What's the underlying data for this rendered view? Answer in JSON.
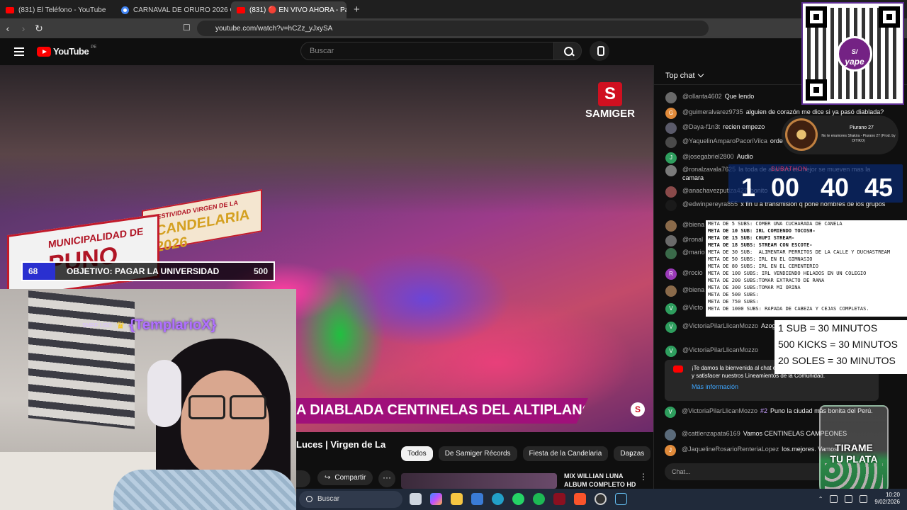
{
  "browser": {
    "tabs": [
      {
        "title": "(831) El Teléfono - YouTube",
        "icon": "youtube-icon",
        "active": false
      },
      {
        "title": "CARNAVAL DE ORURO 2026 CUANDO",
        "icon": "google-icon",
        "active": false
      },
      {
        "title": "(831) 🔴 EN VIVO AHORA - Para",
        "icon": "youtube-icon",
        "active": true
      }
    ],
    "url": "youtube.com/watch?v=hCZz_yJxySA"
  },
  "youtube": {
    "logo_text": "YouTube",
    "region": "PE",
    "search_placeholder": "Buscar"
  },
  "video": {
    "banner_municipal_l1": "MUNICIPALIDAD DE",
    "banner_municipal_l2": "PUNO",
    "banner_festival": "FESTIVIDAD VIRGEN DE LA",
    "banner_candelaria": "CANDELARIA 2026",
    "channel_logo_letter": "S",
    "channel_logo_text": "SAMIGER",
    "goal_current": "68",
    "goal_text": "OBJETIVO: PAGAR LA UNIVERSIDAD",
    "goal_max": "500",
    "goal_progress": 0.136,
    "lower_third": "A DIABLADA CENTINELAS DEL ALTIPLANO",
    "corner_mark": "S"
  },
  "webcam": {
    "sub_alert_pre": "SMRF USD",
    "sub_alert_name": "{TemplarioX}"
  },
  "below_video": {
    "title": "Luces | Virgen de La",
    "chips": [
      "Todos",
      "De Samiger Récords",
      "Fiesta de la Candelaria",
      "Danzas"
    ],
    "share_label": "Compartir",
    "rec_title": "MIX WILLIAN LUNA ALBUM COMPLETO HD"
  },
  "chat": {
    "header": "Top chat",
    "messages": [
      {
        "author": "@ollanta4602",
        "text": "Que lendo",
        "color": "#6a6a6a",
        "initial": ""
      },
      {
        "author": "@guimeralvarez9735",
        "text": "alguien de corazón me dice si ya pasó diablada?",
        "color": "#e08a3a",
        "initial": "G"
      },
      {
        "author": "@Daya-f1n3t",
        "text": "recien empezo",
        "color": "#5a5a6a",
        "initial": ""
      },
      {
        "author": "@YaquelinAmparoPacoriVilca",
        "text": "orde",
        "color": "#4a4a4a",
        "initial": ""
      },
      {
        "author": "@josegabriel2800",
        "text": "Audio",
        "color": "#2e9e5e",
        "initial": "J"
      },
      {
        "author": "@ronalzavala7625",
        "text": "la toda de allamiro es mejor se mueven mas la camara",
        "color": "#7a7a7a",
        "initial": ""
      },
      {
        "author": "@anachavezputiza427",
        "text": "bonito",
        "color": "#8a4a4a",
        "initial": ""
      },
      {
        "author": "@edwinpereyra855",
        "text": "x fin u a transmision q pone nombres de los grupos",
        "color": "#1a1a1a",
        "initial": ""
      },
      {
        "author": "@biena",
        "text": "",
        "color": "#8a6a4a",
        "initial": ""
      },
      {
        "author": "@ronal",
        "text": "",
        "color": "#6a6a6a",
        "initial": ""
      },
      {
        "author": "@mario",
        "text": "Candel",
        "color": "#3a6a4a",
        "initial": ""
      },
      {
        "author": "@rocio",
        "text": "mamita",
        "color": "#9a3ab8",
        "initial": "R"
      },
      {
        "author": "@biena",
        "text": "",
        "color": "#8a6a4a",
        "initial": ""
      },
      {
        "author": "@Victo",
        "text": "",
        "color": "#2e9e5e",
        "initial": "V"
      },
      {
        "author": "@VictoriaPilarLlicanMozzo",
        "text": "Azoguini 🏆",
        "color": "#2e9e5e",
        "initial": "V"
      },
      {
        "author": "@VictoriaPilarLlicanMozzo",
        "text": "",
        "color": "#2e9e5e",
        "initial": "V"
      }
    ],
    "notice_text": "¡Te damos la bienvenida al chat en vivo! Recuerda proteger tu privacidad y satisfacer nuestros Lineamientos de la Comunidad.",
    "notice_link": "Más información",
    "later_messages": [
      {
        "author": "@VictoriaPilarLlicanMozzo",
        "badge": "#2",
        "text": "Puno la ciudad más bonita del Perú.",
        "color": "#2e9e5e",
        "initial": "V"
      },
      {
        "author": "@cattlenzapata6169",
        "badge": "",
        "text": "Vamos CENTINELAS CAMPEONES",
        "color": "#5a6a7a",
        "initial": ""
      },
      {
        "author": "@JaquelineRosarioRenteriaLopez",
        "badge": "",
        "text": "los.mejores. Vamos",
        "color": "#e08a3a",
        "initial": "J"
      }
    ],
    "input_placeholder": "Chat..."
  },
  "overlays": {
    "qr_label": "yape",
    "qr_symbol": "S/",
    "now_playing_title": "Piurano 27",
    "now_playing_sub": "No te enamores Shakira - Piurano 27 (Prod. by DITIKO)",
    "timer_header": "SUBATHON",
    "timer": [
      "1",
      "00",
      "40",
      "45"
    ],
    "metas": [
      {
        "text": "META DE 5 SUBS: COMER UNA CUCHARADA DE CANELA",
        "bold": false
      },
      {
        "text": "META DE 10 SUB: IRL COMIENDO TOCOSH-",
        "bold": true
      },
      {
        "text": "META DE 15 SUB: CHUPI STREAM-",
        "bold": true
      },
      {
        "text": "META DE 18 SUBS: STREAM CON ESCOTE-",
        "bold": true
      },
      {
        "text": "META DE 30 SUB:  ALIMENTAR PERRITOS DE LA CALLE Y DUCHASTREAM",
        "bold": false
      },
      {
        "text": "META DE 50 SUBS: IRL EN EL GIMNASIO",
        "bold": false
      },
      {
        "text": "META DE 80 SUBS: IRL EN EL CEMENTERIO",
        "bold": false
      },
      {
        "text": "META DE 100 SUBS: IRL VENDIENDO HELADOS EN UN COLEGIO",
        "bold": false
      },
      {
        "text": "META DE 200 SUBS:TOMAR EXTRACTO DE RANA",
        "bold": false
      },
      {
        "text": "META DE 300 SUBS:TOMAR MI ORINA",
        "bold": false
      },
      {
        "text": "META DE 500 SUBS:",
        "bold": false
      },
      {
        "text": "META DE 750 SUBS:",
        "bold": false
      },
      {
        "text": "META DE 1000 SUBS: RAPADA DE CABEZA Y CEJAS COMPLETAS.",
        "bold": false
      }
    ],
    "rates": [
      "1 SUB = 30 MINUTOS",
      "500 KICKS = 30 MINUTOS",
      "20 SOLES = 30 MINUTOS"
    ],
    "jar_text_1": "TIRAME",
    "jar_text_2": "TU PLATA"
  },
  "taskbar": {
    "search_label": "Buscar",
    "time": "10:20",
    "date": "9/02/2026"
  }
}
